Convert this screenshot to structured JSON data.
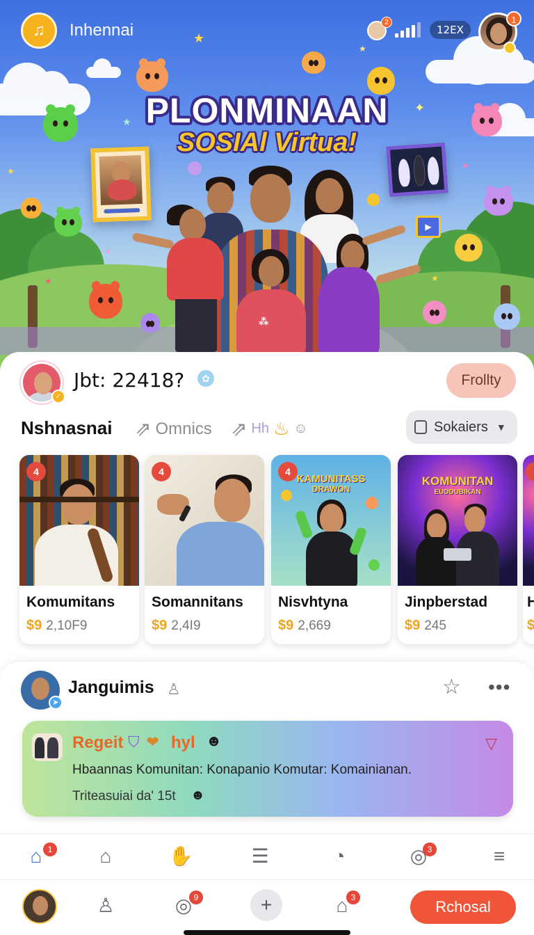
{
  "header": {
    "app_name": "Inhennai",
    "counter": "12EX",
    "avatar_badge": "1",
    "status_badge": "2"
  },
  "hero": {
    "title_line1": "PLONMINAAN",
    "title_line2": "SOSIAl Virtua!"
  },
  "profile": {
    "title": "Jbt: 22418?",
    "follow_label": "Frollty"
  },
  "section": {
    "title": "Nshnasnai",
    "link1": "Omnics",
    "link2": "Hh",
    "sort_label": "Sokaiers"
  },
  "cards": [
    {
      "name": "Komumitans",
      "count": "2,10F9",
      "badge": "4"
    },
    {
      "name": "Somannitans",
      "count": "2,4I9",
      "badge": "4"
    },
    {
      "name": "Nisvhtyna",
      "count": "2,669",
      "badge": "4",
      "art_line1": "KAMUNITASS",
      "art_line2": "DRAWON"
    },
    {
      "name": "Jinpberstad",
      "count": "245",
      "art_line1": "KOMUNITAN",
      "art_line2": "EUDDUBIKAN"
    },
    {
      "name": "H"
    }
  ],
  "post": {
    "author": "Janguimis",
    "title": "Regeit",
    "title2": "hyl",
    "body": "Hbaannas Komunitan: Konapanio Komutar: Komainianan.",
    "footer": "Triteasuiai da' 15t"
  },
  "nav_top": {
    "home_badge": "1",
    "hub_badge": "3"
  },
  "nav_bottom": {
    "discover_badge": "9",
    "alerts_badge": "3",
    "cta_label": "Rchosal"
  },
  "colors": {
    "accent": "#f0553a",
    "brand": "#3d6fe0",
    "follow_bg": "#f6c4b8"
  }
}
